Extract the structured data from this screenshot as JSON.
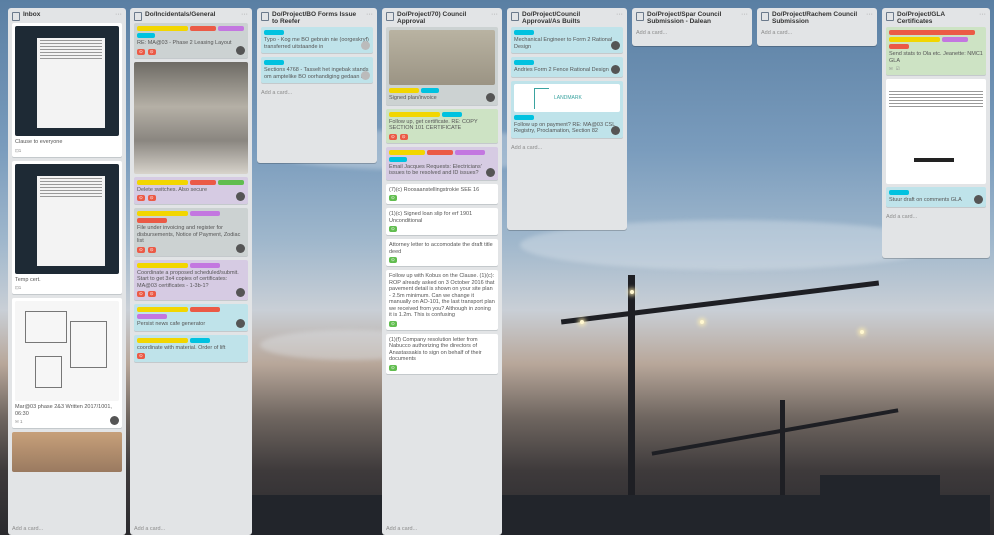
{
  "colors": {
    "board_bg_top": "#5a7fa3",
    "list_bg": "#e2e4e6",
    "label_yellow": "#f2d600",
    "label_blue": "#00c2e0",
    "label_green": "#61bd4f",
    "label_red": "#eb5a46",
    "label_purple": "#c377e0"
  },
  "lists": [
    {
      "title": "Inbox",
      "cards": [
        "Clause to everyone",
        "Temp cert.",
        "Mar@03 phase 2&3 Written 2017/1001, 06:30"
      ],
      "add": "Add a card..."
    },
    {
      "title": "Do/Incidentals/General",
      "cards": [
        "RE: MA@03 - Phase 2 Leasing Layout",
        "Delete switches. Also secure",
        "File under invoicing and register for disbursements, Notice of Payment, Zodiac list",
        "Coordinate a proposed scheduled/submit. Start to get 3x4 copies of certificates: MA@03 certificates - 1-3b-1?",
        "Persist news cafe generator",
        "coordinate with material. Order of lift"
      ],
      "add": "Add a card..."
    },
    {
      "title": "Do/Project/BO Forms Issue to Reefer",
      "cards": [
        "Typo - Kog me BO gebruin nie (oorgeskryf) transferred uitstaande in",
        "Sections 4768 - Tasselt het ingebak stands om amptelike BO oorhandiging gedaan te"
      ],
      "add": "Add a card..."
    },
    {
      "title": "Do/Project/70) Council Approval",
      "cards": [
        "Signed plan/invoice",
        "Follow up, get certificate. RE: COPY SECTION 101 CERTIFICATE",
        "Email Jacques Requests: Electricians' issues to be resolved and ID issues?",
        "(7)(c) Roosaanstellingstrokie SEE 16",
        "(1)(c) Signed loan slip for erf 1901 Unconditional",
        "Attorney letter to accomodate the draft title deed",
        "Follow up with Kobus on the Clause. (1)(c): ROP already asked on 3 October 2016 that pavement detail is shown on your site plan - 2.5m minimum. Can we change it manually on AO-101, the last transport plan we received from you? Although in zoning it is 1.2m. This is confusing",
        "(1)(f) Company resolution letter from Nabucco authorizing the directors of Anastassakis to sign on behalf of their documents"
      ],
      "add": "Add a card..."
    },
    {
      "title": "Do/Project/Council Approval/As Builts",
      "cards": [
        "Mechanical Engineer to Form 2 Rational Design",
        "Andries Form 2 Fence Rational Design",
        "Follow up on payment? RE: MA@03 CSL Registry, Proclamation, Section 82"
      ],
      "landmark": "LANDMARK",
      "add": "Add a card..."
    },
    {
      "title": "Do/Project/Spar Council Submission - Dalean",
      "cards": [],
      "add": "Add a card..."
    },
    {
      "title": "Do/Project/Rachem Council Submission",
      "cards": [],
      "add": "Add a card..."
    },
    {
      "title": "Do/Project/GLA Certificates",
      "cards": [
        "Send stats to Ola etc. Jeanette: NMC1 GLA",
        "Stuur draft on comments GLA"
      ],
      "add": "Add a card..."
    }
  ]
}
